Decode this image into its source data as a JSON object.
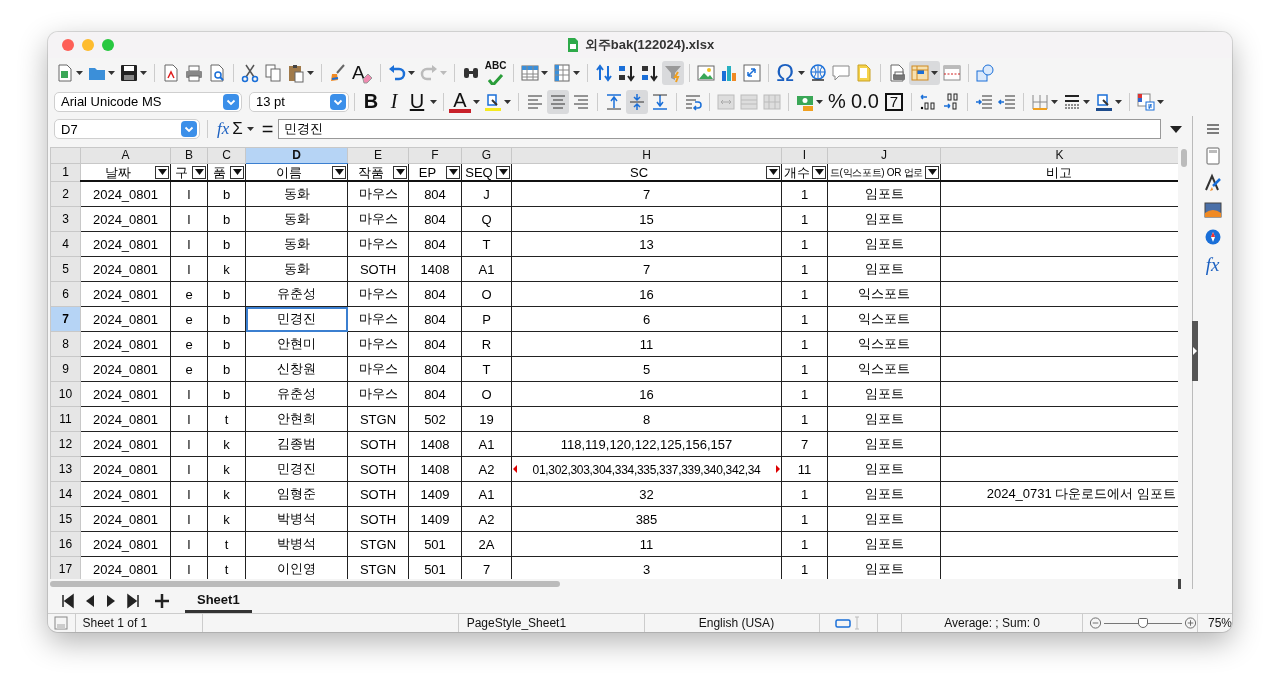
{
  "window": {
    "title": "외주bak(122024).xlsx"
  },
  "toolbar": {
    "spellcheck_label": "ABC",
    "special_character": "Ω",
    "redo_disabled": true,
    "autofilter_on": true,
    "freeze_on": true
  },
  "formatting": {
    "font_name": "Arial Unicode MS",
    "font_size": "13 pt",
    "bold": "B",
    "italic": "I",
    "underline": "U",
    "font_color": "A",
    "clear_format": "A",
    "align_center_on": true,
    "align_middle_on": true,
    "percent": "%",
    "decimal_format": "0.0",
    "number_format": "7"
  },
  "formula_bar": {
    "cell_reference": "D7",
    "function_wizard": "fx",
    "sum": "Σ",
    "equals": "=",
    "content": "민경진"
  },
  "columns": [
    {
      "letter": "A",
      "selected": false
    },
    {
      "letter": "B",
      "selected": false
    },
    {
      "letter": "C",
      "selected": false
    },
    {
      "letter": "D",
      "selected": true
    },
    {
      "letter": "E",
      "selected": false
    },
    {
      "letter": "F",
      "selected": false
    },
    {
      "letter": "G",
      "selected": false
    },
    {
      "letter": "H",
      "selected": false
    },
    {
      "letter": "I",
      "selected": false
    },
    {
      "letter": "J",
      "selected": false
    },
    {
      "letter": "K",
      "selected": false
    }
  ],
  "header_row": {
    "number": "1",
    "cells": [
      {
        "text": "날짜",
        "filter": true
      },
      {
        "text": "구",
        "filter": true
      },
      {
        "text": "품",
        "filter": true
      },
      {
        "text": "이름",
        "filter": true
      },
      {
        "text": "작품",
        "filter": true
      },
      {
        "text": "EP",
        "filter": true
      },
      {
        "text": "SEQ",
        "filter": true
      },
      {
        "text": "SC",
        "filter": true
      },
      {
        "text": "개수",
        "filter": true
      },
      {
        "text": "드(익스포트) OR 업로",
        "filter": true
      },
      {
        "text": "비고",
        "filter": false
      }
    ]
  },
  "rows": [
    {
      "number": "2",
      "selected": false,
      "cells": [
        "2024_0801",
        "l",
        "b",
        "동화",
        "마우스",
        "804",
        "J",
        "7",
        "1",
        "임포트",
        ""
      ]
    },
    {
      "number": "3",
      "selected": false,
      "cells": [
        "2024_0801",
        "l",
        "b",
        "동화",
        "마우스",
        "804",
        "Q",
        "15",
        "1",
        "임포트",
        ""
      ]
    },
    {
      "number": "4",
      "selected": false,
      "cells": [
        "2024_0801",
        "l",
        "b",
        "동화",
        "마우스",
        "804",
        "T",
        "13",
        "1",
        "임포트",
        ""
      ]
    },
    {
      "number": "5",
      "selected": false,
      "cells": [
        "2024_0801",
        "l",
        "k",
        "동화",
        "SOTH",
        "1408",
        "A1",
        "7",
        "1",
        "임포트",
        ""
      ]
    },
    {
      "number": "6",
      "selected": false,
      "cells": [
        "2024_0801",
        "e",
        "b",
        "유춘성",
        "마우스",
        "804",
        "O",
        "16",
        "1",
        "익스포트",
        ""
      ]
    },
    {
      "number": "7",
      "selected": true,
      "cells": [
        "2024_0801",
        "e",
        "b",
        "민경진",
        "마우스",
        "804",
        "P",
        "6",
        "1",
        "익스포트",
        ""
      ]
    },
    {
      "number": "8",
      "selected": false,
      "cells": [
        "2024_0801",
        "e",
        "b",
        "안현미",
        "마우스",
        "804",
        "R",
        "11",
        "1",
        "익스포트",
        ""
      ]
    },
    {
      "number": "9",
      "selected": false,
      "cells": [
        "2024_0801",
        "e",
        "b",
        "신창원",
        "마우스",
        "804",
        "T",
        "5",
        "1",
        "익스포트",
        ""
      ]
    },
    {
      "number": "10",
      "selected": false,
      "cells": [
        "2024_0801",
        "l",
        "b",
        "유춘성",
        "마우스",
        "804",
        "O",
        "16",
        "1",
        "임포트",
        ""
      ]
    },
    {
      "number": "11",
      "selected": false,
      "cells": [
        "2024_0801",
        "l",
        "t",
        "안현희",
        "STGN",
        "502",
        "19",
        "8",
        "1",
        "임포트",
        ""
      ]
    },
    {
      "number": "12",
      "selected": false,
      "cells": [
        "2024_0801",
        "l",
        "k",
        "김종범",
        "SOTH",
        "1408",
        "A1",
        "118,119,120,122,125,156,157",
        "7",
        "임포트",
        ""
      ]
    },
    {
      "number": "13",
      "selected": false,
      "cells": [
        "2024_0801",
        "l",
        "k",
        "민경진",
        "SOTH",
        "1408",
        "A2",
        {
          "text": "01,302,303,304,334,335,337,339,340,342,34",
          "overflow": true
        },
        "11",
        "임포트",
        ""
      ]
    },
    {
      "number": "14",
      "selected": false,
      "cells": [
        "2024_0801",
        "l",
        "k",
        "임형준",
        "SOTH",
        "1409",
        "A1",
        "32",
        "1",
        "임포트",
        "2024_0731 다운로드에서 임포트"
      ]
    },
    {
      "number": "15",
      "selected": false,
      "cells": [
        "2024_0801",
        "l",
        "k",
        "박병석",
        "SOTH",
        "1409",
        "A2",
        "385",
        "1",
        "임포트",
        ""
      ]
    },
    {
      "number": "16",
      "selected": false,
      "cells": [
        "2024_0801",
        "l",
        "t",
        "박병석",
        "STGN",
        "501",
        "2A",
        "11",
        "1",
        "임포트",
        ""
      ]
    },
    {
      "number": "17",
      "selected": false,
      "cells": [
        "2024_0801",
        "l",
        "t",
        "이인영",
        "STGN",
        "501",
        "7",
        "3",
        "1",
        "임포트",
        ""
      ]
    }
  ],
  "sheet_tabs": [
    {
      "label": "Sheet1",
      "selected": true
    }
  ],
  "sidebar": {
    "functions": "fx"
  },
  "status_bar": {
    "sheet": "Sheet 1 of 1",
    "page_style": "PageStyle_Sheet1",
    "language": "English (USA)",
    "summary": "Average: ; Sum: 0",
    "zoom": {
      "level": 0.5,
      "reading": "75%"
    }
  }
}
